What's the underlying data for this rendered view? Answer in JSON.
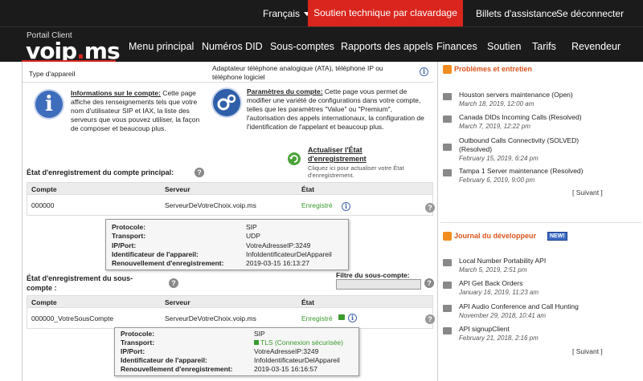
{
  "topbar": {
    "language": "Français",
    "support_button": "Soutien technique par clavardage",
    "tickets": "Billets d'assistance",
    "logout": "Se déconnecter"
  },
  "brand": {
    "portal_label": "Portail Client",
    "logo_a": "voip",
    "logo_b": ".",
    "logo_c": "ms"
  },
  "nav": {
    "items": [
      "Menu principal",
      "Numéros DID",
      "Sous-comptes",
      "Rapports des appels",
      "Finances",
      "Soutien",
      "Tarifs",
      "Revendeur"
    ]
  },
  "device": {
    "label": "Type d'appareil",
    "value": "Adaptateur téléphone analogique (ATA), téléphone IP ou téléphone logiciel"
  },
  "account_info": {
    "title": "Informations sur le compte:",
    "text": " Cette page affiche des renseignements tels que votre nom d'utilisateur SIP et IAX, la liste des serveurs que vous pouvez utiliser, la façon de composer et beaucoup plus."
  },
  "settings_info": {
    "title": "Paramètres du compte:",
    "text": " Cette page vous permet de modifier une variété de configurations dans votre compte, telles que les paramètres \"Value\" ou \"Premium\", l'autorisation des appels internationaux, la configuration de l'identification de l'appelant et beaucoup plus."
  },
  "refresh": {
    "title": "Actualiser l'État d'enregistrement",
    "desc": "Cliquez ici pour actualiser votre État d'enregistrement."
  },
  "main_registration": {
    "title": "État d'enregistrement du compte principal:",
    "headers": [
      "Compte",
      "Serveur",
      "État"
    ],
    "row": {
      "account": "000000",
      "server": "ServeurDeVotreChoix.voip.ms",
      "state": "Enregistré"
    },
    "tooltip": {
      "protocol_k": "Protocole:",
      "protocol_v": "SIP",
      "transport_k": "Transport:",
      "transport_v": "UDP",
      "ip_k": "IP/Port:",
      "ip_v": "VotreAdresseIP:3249",
      "id_k": "Identificateur de l'appareil:",
      "id_v": "InfoIdentificateurDelAppareil",
      "renew_k": "Renouvellement d'enregistrement:",
      "renew_v": "2019-03-15 16:13:27"
    }
  },
  "sub_registration": {
    "title": "État d'enregistrement du sous-compte :",
    "filter_label": "Filtre du sous-compte:",
    "headers": [
      "Compte",
      "Serveur",
      "État"
    ],
    "row": {
      "account": "000000_VotreSousCompte",
      "server": "ServeurDeVotreChoix.voip.ms",
      "state": "Enregistré"
    },
    "tooltip": {
      "protocol_k": "Protocole:",
      "protocol_v": "SIP",
      "transport_k": "Transport:",
      "transport_v": "TLS (Connexion sécurisée)",
      "ip_k": "IP/Port:",
      "ip_v": "VotreAdresseIP:3249",
      "id_k": "Identificateur de l'appareil:",
      "id_v": "InfoIdentificateurDelAppareil",
      "renew_k": "Renouvellement d'enregistrement:",
      "renew_v": "2019-03-15 16:16:57"
    }
  },
  "problems": {
    "title": "Problèmes et entretien",
    "items": [
      {
        "title": "Houston servers maintenance (Open)",
        "date": "March 18, 2019, 12:00 am"
      },
      {
        "title": "Canada DIDs Incoming Calls (Resolved)",
        "date": "March 7, 2019, 12:22 pm"
      },
      {
        "title": "Outbound Calls Connectivity (SOLVED)",
        "title2": "(Resolved)",
        "date": "February 15, 2019, 6:24 pm"
      },
      {
        "title": "Tampa 1 Server maintenance (Resolved)",
        "date": "February 6, 2019, 9:00 pm"
      }
    ],
    "more": "[ Suivant ]"
  },
  "devlog": {
    "title": "Journal du développeur",
    "badge": "NEW!",
    "items": [
      {
        "title": "Local Number Portability API",
        "date": "March 5, 2019, 2:51 pm"
      },
      {
        "title": "API Get Back Orders",
        "date": "January 16, 2019, 11:23 am"
      },
      {
        "title": "API Audio Conference and Call Hunting",
        "date": "November 29, 2018, 10:41 am"
      },
      {
        "title": "API signupClient",
        "date": "February 21, 2018, 2:16 pm"
      }
    ],
    "more": "[ Suivant ]"
  },
  "colors": {
    "accent": "#d9251d",
    "nav_bg": "#1b1b1b",
    "ok": "#3a9a2e",
    "rss": "#f28c1f"
  }
}
